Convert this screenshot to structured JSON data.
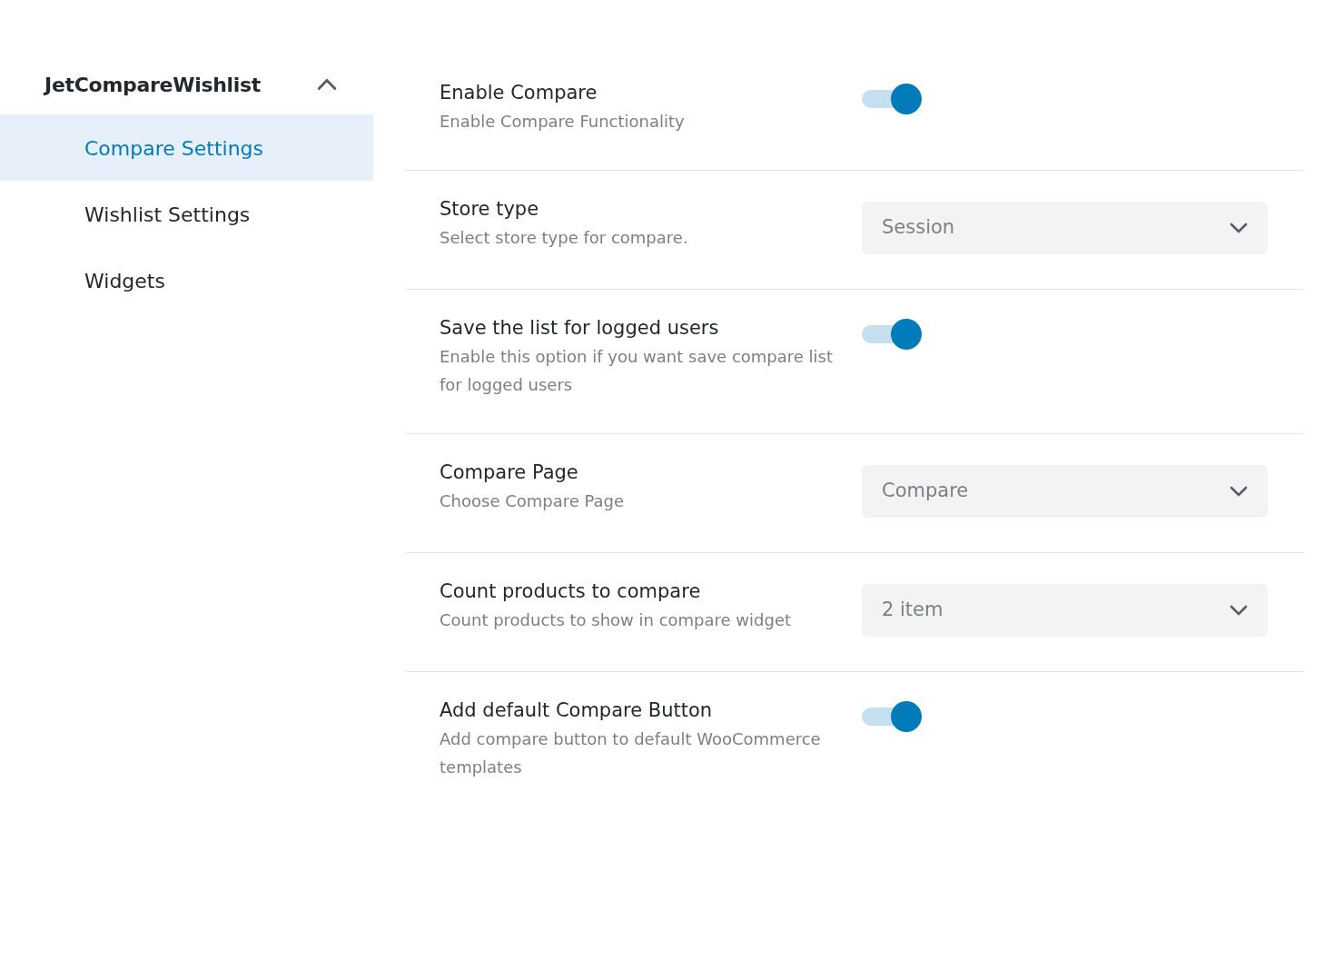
{
  "sidebar": {
    "title": "JetCompareWishlist",
    "expanded": true,
    "items": [
      {
        "label": "Compare Settings",
        "selected": true
      },
      {
        "label": "Wishlist Settings",
        "selected": false
      },
      {
        "label": "Widgets",
        "selected": false
      }
    ]
  },
  "settings": [
    {
      "kind": "toggle",
      "title": "Enable Compare",
      "description": "Enable Compare Functionality",
      "on": true
    },
    {
      "kind": "select",
      "title": "Store type",
      "description": "Select store type for compare.",
      "value": "Session"
    },
    {
      "kind": "toggle",
      "title": "Save the list for logged users",
      "description": "Enable this option if you want save compare list for logged users",
      "on": true
    },
    {
      "kind": "select",
      "title": "Compare Page",
      "description": "Choose Compare Page",
      "value": "Compare"
    },
    {
      "kind": "select",
      "title": "Count products to compare",
      "description": "Count products to show in compare widget",
      "value": "2 item"
    },
    {
      "kind": "toggle",
      "title": "Add default Compare Button",
      "description": "Add compare button to default WooCommerce templates",
      "on": true
    }
  ]
}
